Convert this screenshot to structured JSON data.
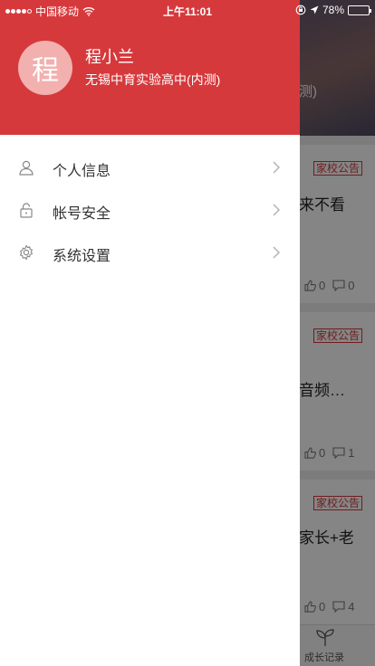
{
  "status_bar": {
    "carrier": "中国移动",
    "time": "上午11:01",
    "battery": "78%",
    "battery_level": 0.78
  },
  "drawer": {
    "avatar_char": "程",
    "user_name": "程小兰",
    "school": "无锡中育实验高中(内测)",
    "menu": [
      {
        "label": "个人信息",
        "icon": "user-icon"
      },
      {
        "label": "帐号安全",
        "icon": "lock-icon"
      },
      {
        "label": "系统设置",
        "icon": "gear-icon"
      }
    ]
  },
  "background": {
    "header_text": "测)",
    "cards": [
      {
        "tag": "家校公告",
        "title": "来不看",
        "likes": "0",
        "comments": "0"
      },
      {
        "tag": "家校公告",
        "title": "音频…",
        "likes": "0",
        "comments": "1"
      },
      {
        "tag": "家校公告",
        "title": "家长+老",
        "likes": "0",
        "comments": "4"
      }
    ],
    "tab_label": "成长记录"
  },
  "colors": {
    "accent": "#d6393c",
    "avatar_bg": "#f2b0ae"
  }
}
